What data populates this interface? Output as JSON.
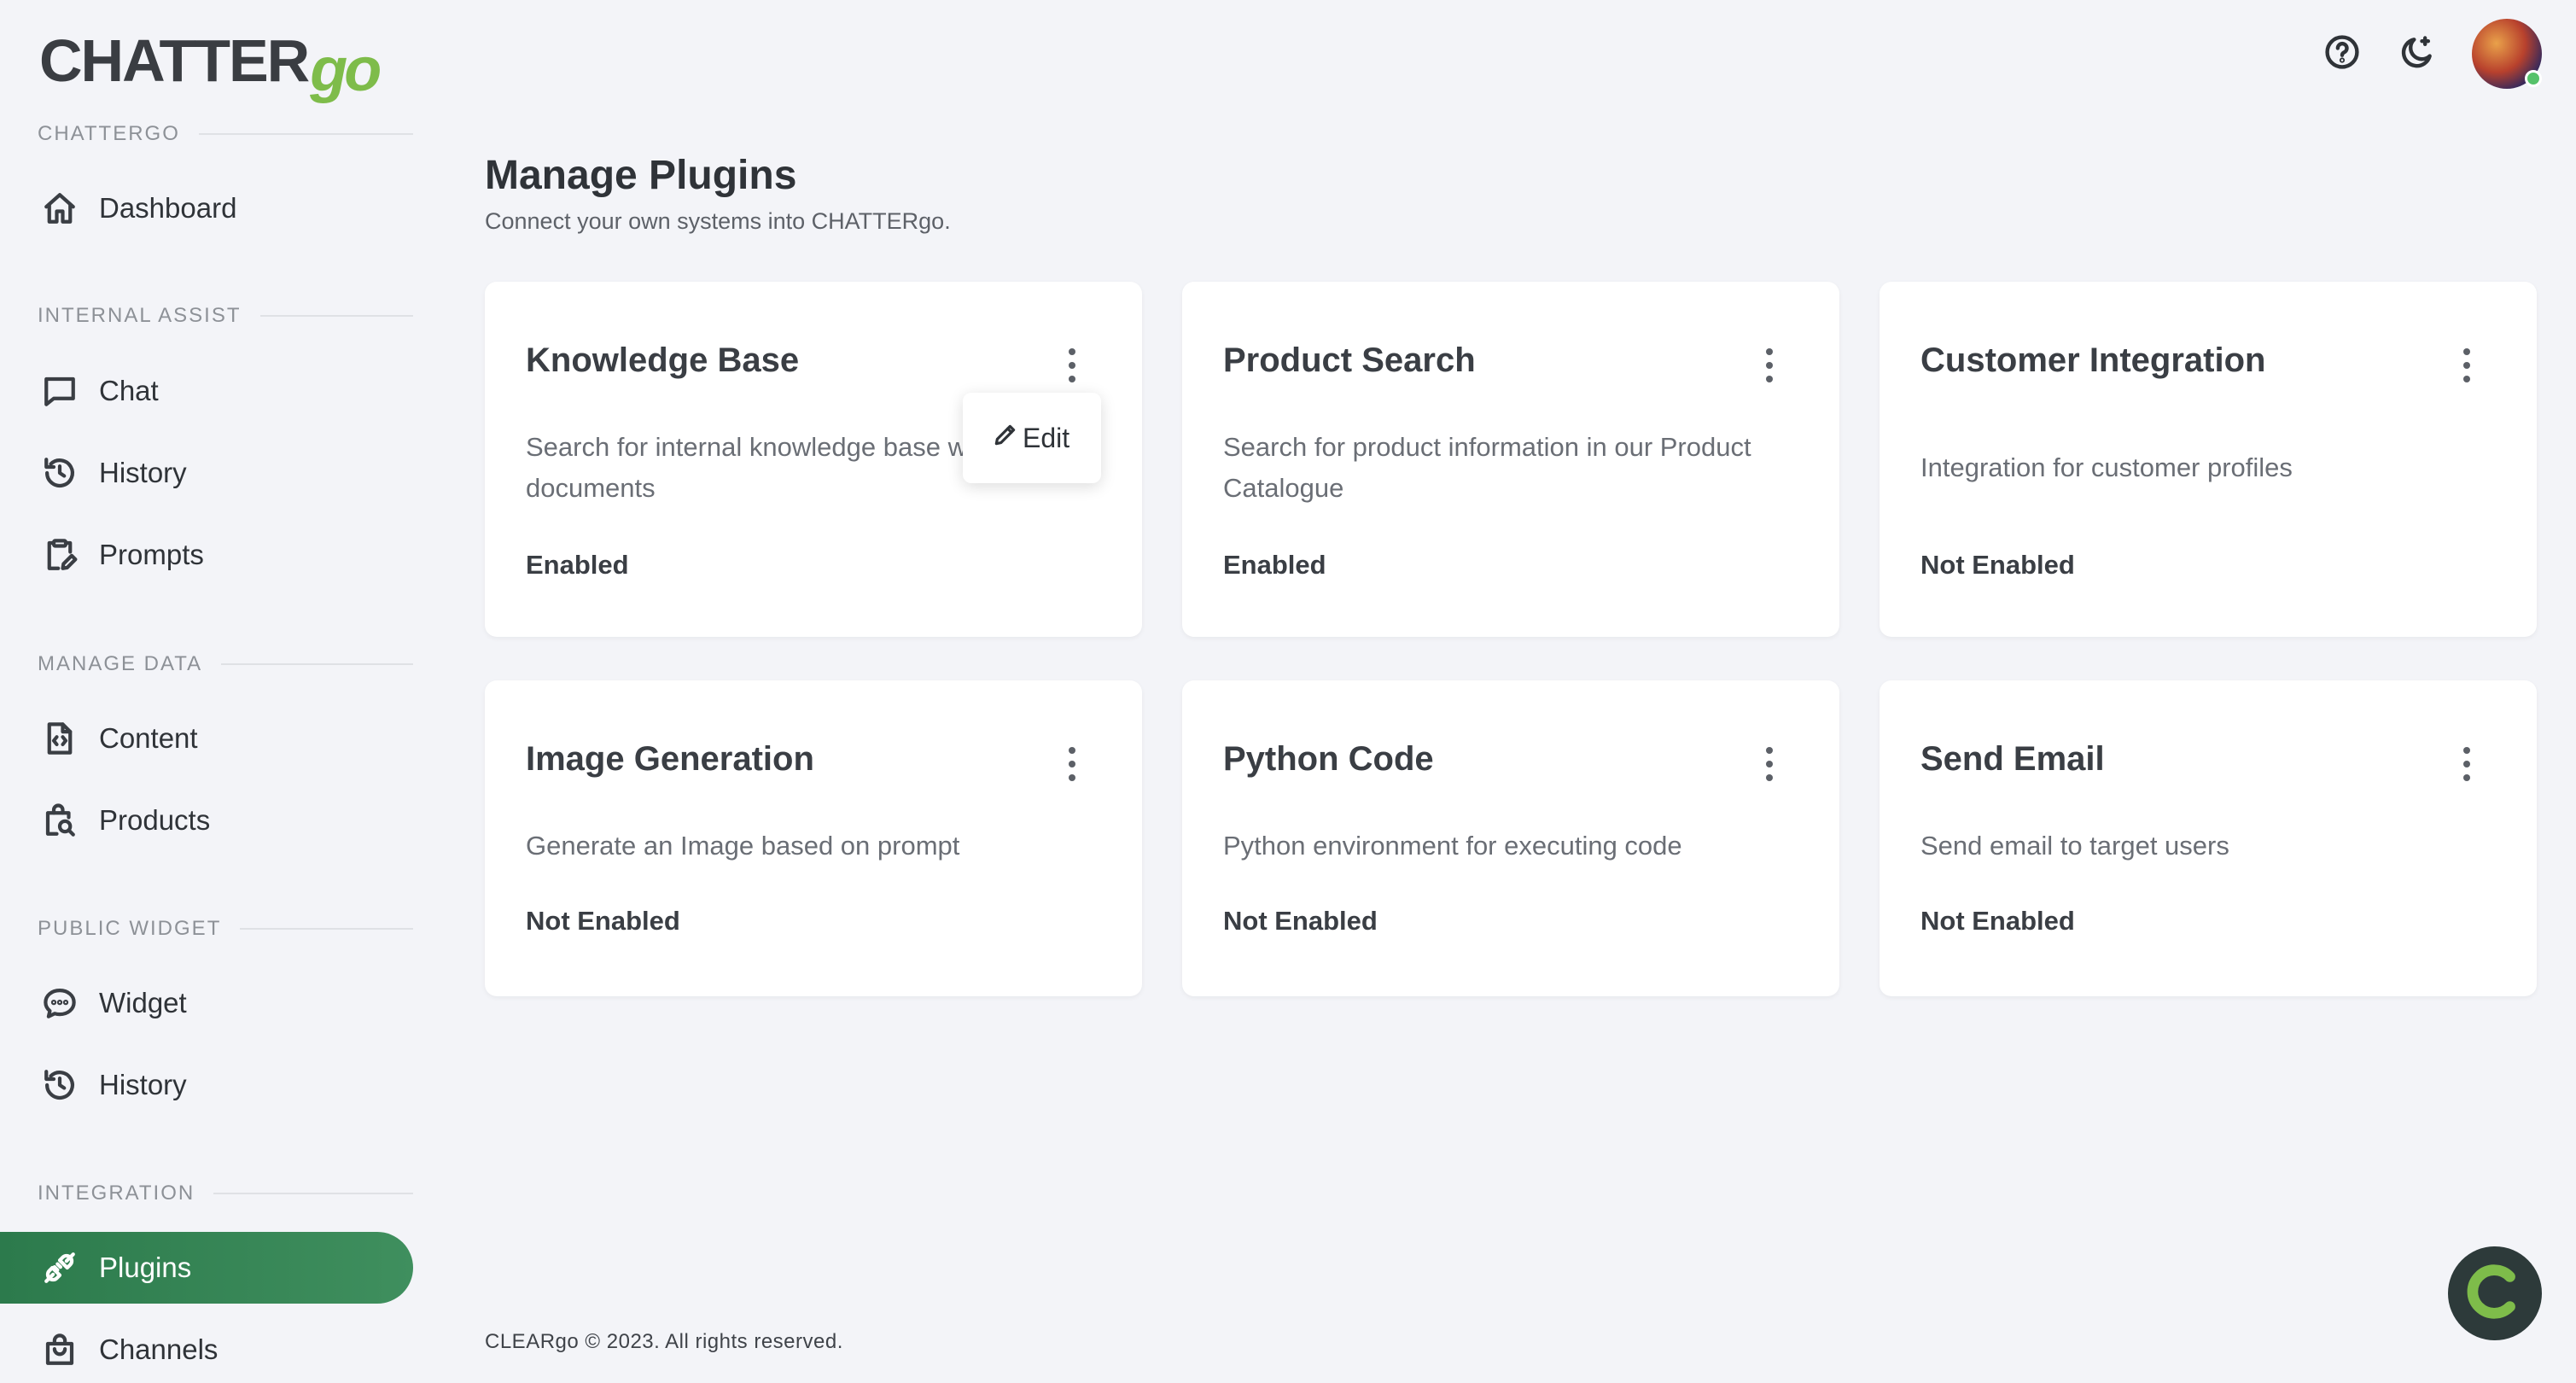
{
  "logo": {
    "main": "CHATTER",
    "suffix": "go"
  },
  "sidebar": {
    "sections": [
      {
        "title": "CHATTERGO",
        "items": [
          {
            "label": "Dashboard",
            "icon": "home-icon"
          }
        ]
      },
      {
        "title": "INTERNAL ASSIST",
        "items": [
          {
            "label": "Chat",
            "icon": "chat-icon"
          },
          {
            "label": "History",
            "icon": "history-icon"
          },
          {
            "label": "Prompts",
            "icon": "clipboard-edit-icon"
          }
        ]
      },
      {
        "title": "MANAGE DATA",
        "items": [
          {
            "label": "Content",
            "icon": "file-code-icon"
          },
          {
            "label": "Products",
            "icon": "product-search-icon"
          }
        ]
      },
      {
        "title": "PUBLIC WIDGET",
        "items": [
          {
            "label": "Widget",
            "icon": "chat-bubble-dots-icon"
          },
          {
            "label": "History",
            "icon": "history-icon"
          }
        ]
      },
      {
        "title": "INTEGRATION",
        "items": [
          {
            "label": "Plugins",
            "icon": "plug-icon",
            "active": true
          },
          {
            "label": "Channels",
            "icon": "bag-icon"
          }
        ]
      }
    ]
  },
  "header": {
    "icons": [
      "help-icon",
      "dark-mode-icon"
    ],
    "avatar_status": "online"
  },
  "main": {
    "title": "Manage Plugins",
    "subtitle": "Connect your own systems into CHATTERgo.",
    "plugins": [
      {
        "title": "Knowledge Base",
        "description": "Search for internal knowledge base websites and documents",
        "status": "Enabled"
      },
      {
        "title": "Product Search",
        "description": "Search for product information in our Product Catalogue",
        "status": "Enabled"
      },
      {
        "title": "Customer Integration",
        "description": "Integration for customer profiles",
        "status": "Not Enabled"
      },
      {
        "title": "Image Generation",
        "description": "Generate an Image based on prompt",
        "status": "Not Enabled"
      },
      {
        "title": "Python Code",
        "description": "Python environment for executing code",
        "status": "Not Enabled"
      },
      {
        "title": "Send Email",
        "description": "Send email to target users",
        "status": "Not Enabled"
      }
    ],
    "context_menu": {
      "edit_label": "Edit"
    }
  },
  "footer": {
    "text": "CLEARgo © 2023. All rights reserved."
  },
  "colors": {
    "accent": "#2c7a4c",
    "brand_go": "#7ebc4a",
    "background": "#f3f4f8"
  }
}
